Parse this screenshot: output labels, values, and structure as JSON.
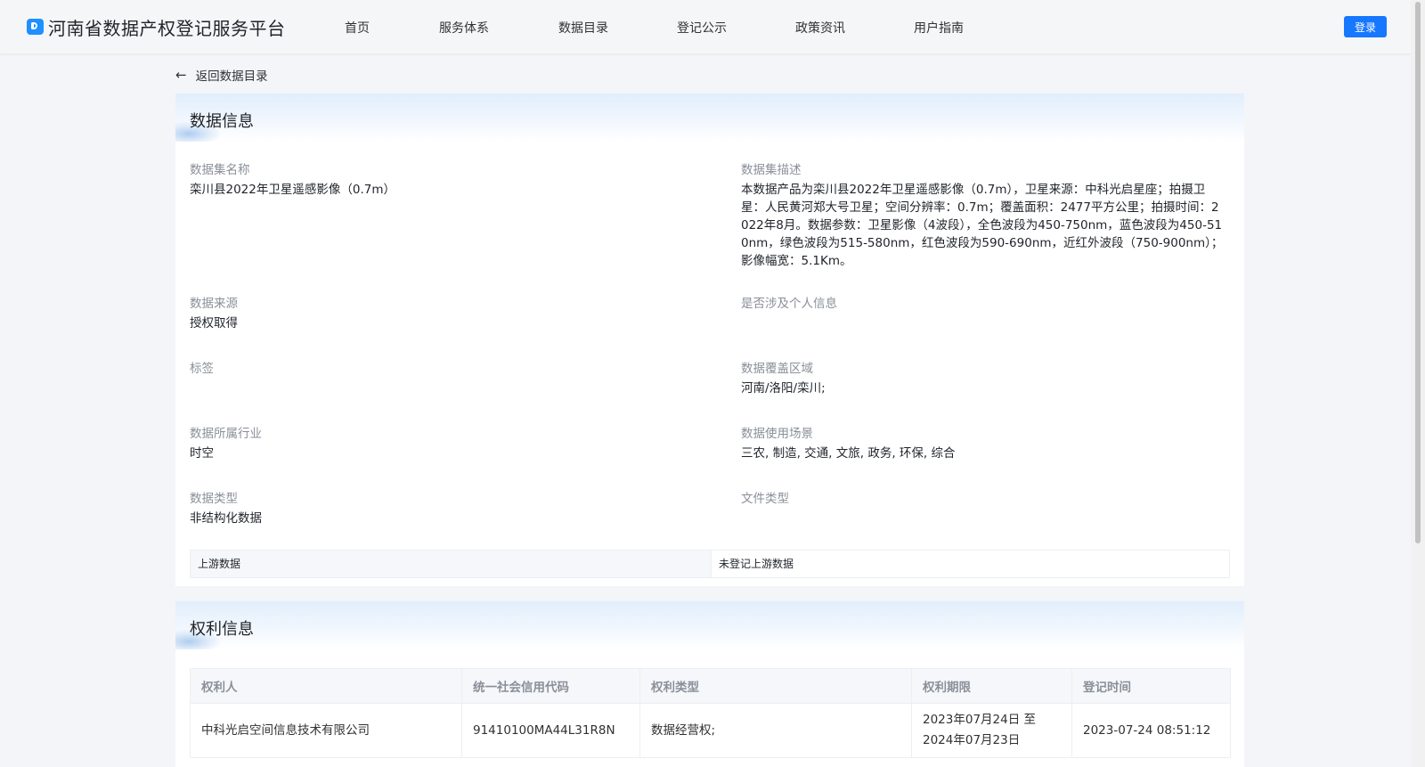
{
  "header": {
    "site_title": "河南省数据产权登记服务平台",
    "nav": [
      "首页",
      "服务体系",
      "数据目录",
      "登记公示",
      "政策资讯",
      "用户指南"
    ],
    "login_label": "登录",
    "accent_color": "#1677ff"
  },
  "back_link": {
    "label": "返回数据目录",
    "icon": "arrow-left-icon"
  },
  "data_info": {
    "title": "数据信息",
    "fields": {
      "dataset_name": {
        "label": "数据集名称",
        "value": "栾川县2022年卫星遥感影像（0.7m）"
      },
      "dataset_desc": {
        "label": "数据集描述",
        "value": "本数据产品为栾川县2022年卫星遥感影像（0.7m），卫星来源：中科光启星座；拍摄卫星：人民黄河郑大号卫星；空间分辨率：0.7m；覆盖面积：2477平方公里；拍摄时间：2022年8月。数据参数：卫星影像（4波段），全色波段为450-750nm，蓝色波段为450-510nm，绿色波段为515-580nm，红色波段为590-690nm，近红外波段（750-900nm）；影像幅宽：5.1Km。"
      },
      "source": {
        "label": "数据来源",
        "value": "授权取得"
      },
      "personal_info": {
        "label": "是否涉及个人信息",
        "value": ""
      },
      "tags": {
        "label": "标签",
        "value": ""
      },
      "coverage": {
        "label": "数据覆盖区域",
        "value": "河南/洛阳/栾川;"
      },
      "industry": {
        "label": "数据所属行业",
        "value": "时空"
      },
      "scenarios": {
        "label": "数据使用场景",
        "value": "三农, 制造, 交通, 文旅, 政务, 环保, 综合"
      },
      "data_type": {
        "label": "数据类型",
        "value": "非结构化数据"
      },
      "file_type": {
        "label": "文件类型",
        "value": ""
      }
    },
    "upstream": {
      "label": "上游数据",
      "value": "未登记上游数据"
    }
  },
  "rights_info": {
    "title": "权利信息",
    "columns": [
      "权利人",
      "统一社会信用代码",
      "权利类型",
      "权利期限",
      "登记时间"
    ],
    "rows": [
      {
        "holder": "中科光启空间信息技术有限公司",
        "credit_code": "91410100MA44L31R8N",
        "right_type": "数据经营权;",
        "term_start": "2023年07月24日 至",
        "term_end": "2024年07月23日",
        "registered_at": "2023-07-24 08:51:12"
      }
    ]
  }
}
